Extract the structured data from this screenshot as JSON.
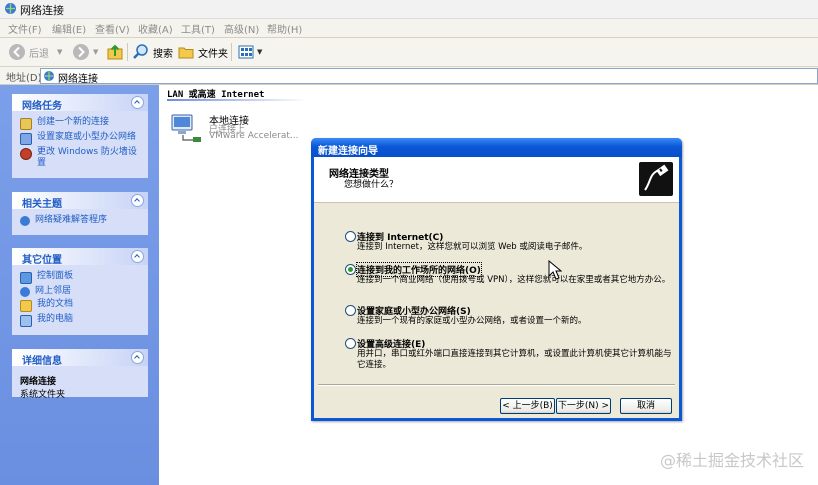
{
  "window": {
    "title": "网络连接"
  },
  "menu": [
    "文件(F)",
    "编辑(E)",
    "查看(V)",
    "收藏(A)",
    "工具(T)",
    "高级(N)",
    "帮助(H)"
  ],
  "toolbar": {
    "back": "后退",
    "search": "搜索",
    "folders": "文件夹"
  },
  "address": {
    "label": "地址(D)",
    "value": "网络连接"
  },
  "tasks": {
    "network": {
      "title": "网络任务",
      "items": [
        "创建一个新的连接",
        "设置家庭或小型办公网络",
        "更改 Windows 防火墙设置"
      ]
    },
    "related": {
      "title": "相关主题",
      "items": [
        "网络疑难解答程序"
      ]
    },
    "other": {
      "title": "其它位置",
      "items": [
        "控制面板",
        "网上邻居",
        "我的文档",
        "我的电脑"
      ]
    },
    "details": {
      "title": "详细信息",
      "name": "网络连接",
      "type": "系统文件夹"
    }
  },
  "main": {
    "section": "LAN 或高速 Internet",
    "lan": {
      "name": "本地连接",
      "status": "已连接上",
      "device": "VMware Accelerat..."
    }
  },
  "wizard": {
    "title": "新建连接向导",
    "heading": "网络连接类型",
    "subheading": "您想做什么？",
    "options": [
      {
        "label": "连接到 Internet(C)",
        "desc": "连接到 Internet，这样您就可以浏览 Web 或阅读电子邮件。",
        "selected": false
      },
      {
        "label": "连接到我的工作场所的网络(O)",
        "desc": "连接到一个商业网络（使用拨号或 VPN），这样您就可以在家里或者其它地方办公。",
        "selected": true
      },
      {
        "label": "设置家庭或小型办公网络(S)",
        "desc": "连接到一个现有的家庭或小型办公网络，或者设置一个新的。",
        "selected": false
      },
      {
        "label": "设置高级连接(E)",
        "desc": "用并口，串口或红外端口直接连接到其它计算机，或设置此计算机使其它计算机能与它连接。",
        "selected": false
      }
    ],
    "buttons": {
      "back": "< 上一步(B)",
      "next": "下一步(N) >",
      "cancel": "取消"
    }
  },
  "watermark": "@稀土掘金技术社区"
}
